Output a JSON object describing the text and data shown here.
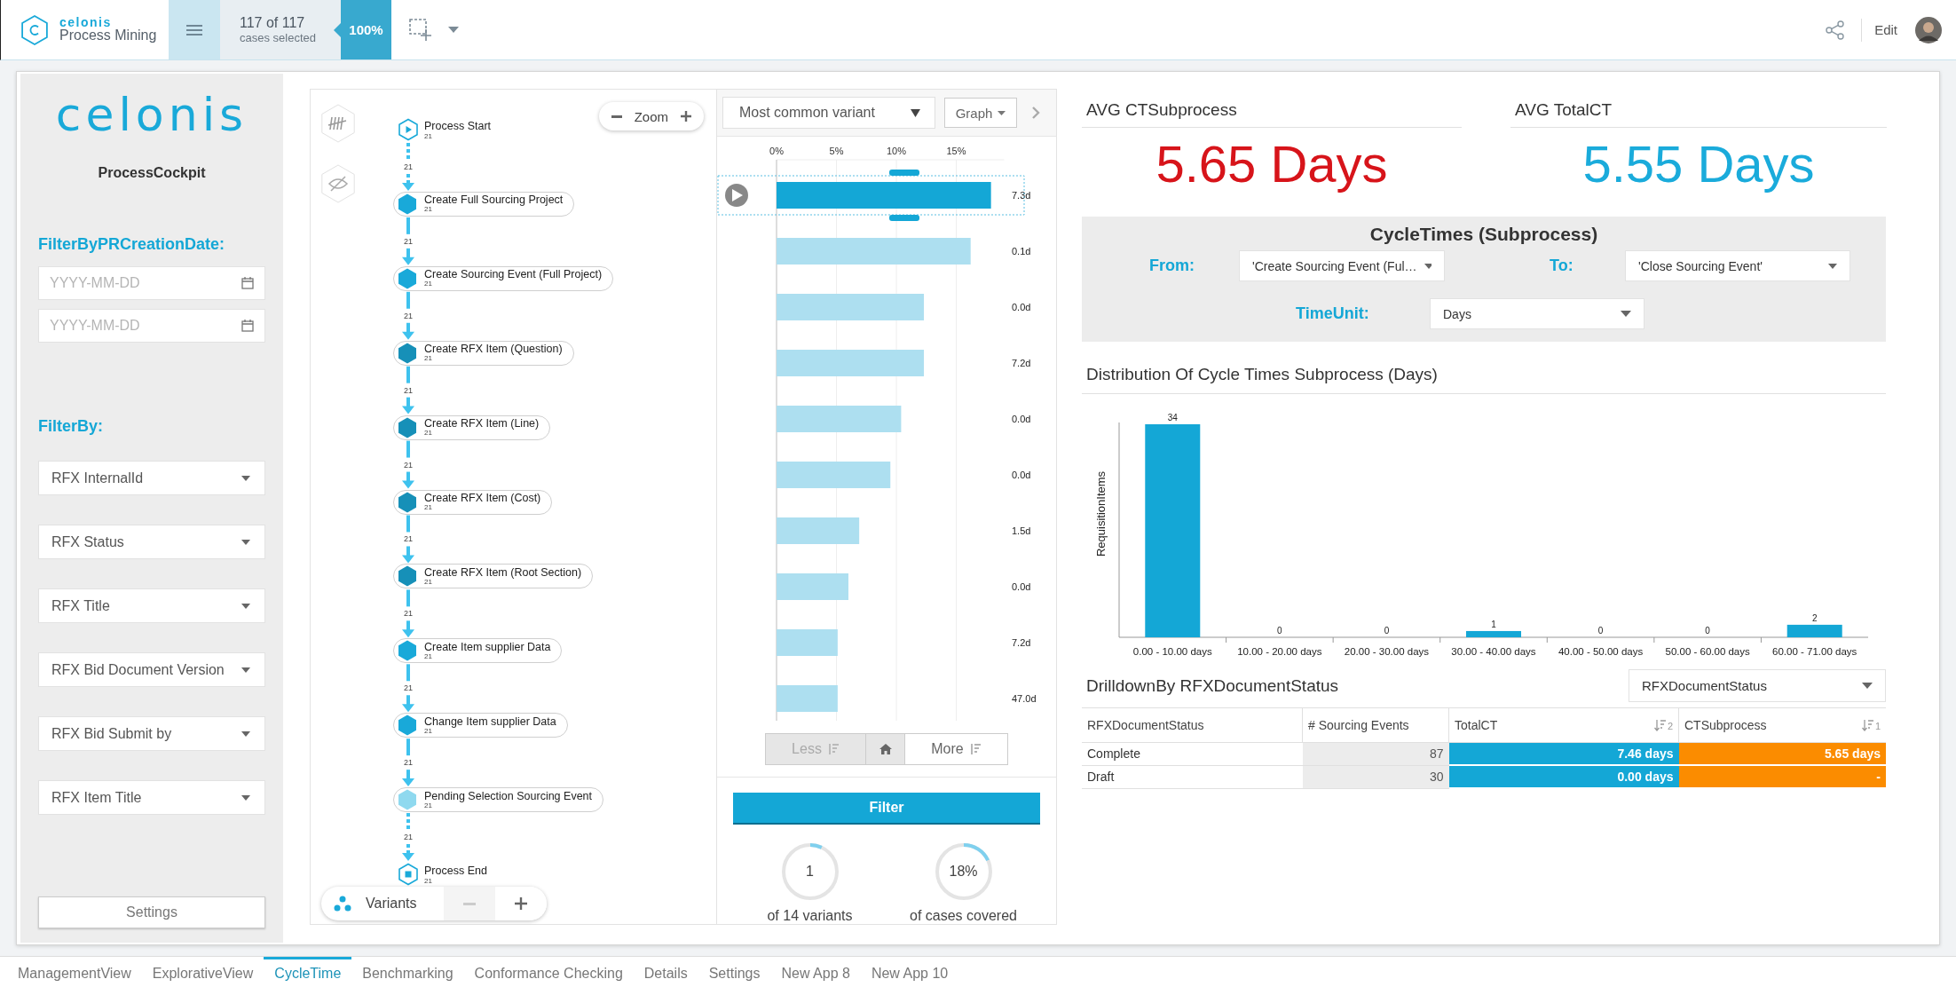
{
  "top_bar": {
    "brand": "celonis",
    "product": "Process Mining",
    "cases": "117 of 117",
    "cases_caption": "cases selected",
    "percent": "100%",
    "edit": "Edit"
  },
  "sidebar": {
    "logo": "celonis",
    "title": "ProcessCockpit",
    "date_heading": "FilterByPRCreationDate:",
    "date_fields": [
      {
        "placeholder": "YYYY-MM-DD"
      },
      {
        "placeholder": "YYYY-MM-DD"
      }
    ],
    "filter_heading": "FilterBy:",
    "filters": [
      "RFX InternalId",
      "RFX Status",
      "RFX Title",
      "RFX Bid Document Version",
      "RFX Bid Submit by",
      "RFX Item Title"
    ],
    "settings": "Settings"
  },
  "process_map": {
    "zoom": "Zoom",
    "variants": "Variants",
    "nodes": [
      {
        "kind": "start",
        "label": "Process Start",
        "count": "21"
      },
      {
        "kind": "activity",
        "label": "Create Full Sourcing Project",
        "count": "21",
        "color": "#19a9d9"
      },
      {
        "kind": "activity",
        "label": "Create Sourcing Event (Full Project)",
        "count": "21",
        "color": "#19a9d9"
      },
      {
        "kind": "activity",
        "label": "Create RFX Item (Question)",
        "count": "21",
        "color": "#1690b8"
      },
      {
        "kind": "activity",
        "label": "Create RFX Item (Line)",
        "count": "21",
        "color": "#1690b8"
      },
      {
        "kind": "activity",
        "label": "Create RFX Item (Cost)",
        "count": "21",
        "color": "#1690b8"
      },
      {
        "kind": "activity",
        "label": "Create RFX Item (Root Section)",
        "count": "21",
        "color": "#1690b8"
      },
      {
        "kind": "activity",
        "label": "Create Item supplier Data",
        "count": "21",
        "color": "#19a9d9"
      },
      {
        "kind": "activity",
        "label": "Change Item supplier Data",
        "count": "21",
        "color": "#19a9d9"
      },
      {
        "kind": "activity",
        "label": "Pending Selection Sourcing Event",
        "count": "21",
        "color": "#8fd9ef"
      },
      {
        "kind": "end",
        "label": "Process End",
        "count": "21"
      }
    ],
    "edges": [
      {
        "label": "21",
        "dashed": true
      },
      {
        "label": "21",
        "dashed": false
      },
      {
        "label": "21",
        "dashed": false
      },
      {
        "label": "21",
        "dashed": false
      },
      {
        "label": "21",
        "dashed": false
      },
      {
        "label": "21",
        "dashed": false
      },
      {
        "label": "21",
        "dashed": false
      },
      {
        "label": "21",
        "dashed": false
      },
      {
        "label": "21",
        "dashed": false
      },
      {
        "label": "21",
        "dashed": true
      }
    ]
  },
  "variant_explorer": {
    "dropdown": "Most common variant",
    "view": "Graph",
    "rows": [
      {
        "selected": true,
        "duration": "7.3d"
      },
      {
        "selected": false,
        "duration": "0.1d"
      },
      {
        "selected": false,
        "duration": "0.0d"
      },
      {
        "selected": false,
        "duration": "7.2d"
      },
      {
        "selected": false,
        "duration": "0.0d"
      },
      {
        "selected": false,
        "duration": "0.0d"
      },
      {
        "selected": false,
        "duration": "1.5d"
      },
      {
        "selected": false,
        "duration": "0.0d"
      },
      {
        "selected": false,
        "duration": "7.2d"
      },
      {
        "selected": false,
        "duration": "47.0d"
      }
    ],
    "chart_data": {
      "type": "bar",
      "orientation": "horizontal",
      "grid": true,
      "xlim": [
        0,
        19
      ],
      "xticks": [
        {
          "value": 0,
          "label": "0%"
        },
        {
          "value": 5,
          "label": "5%"
        },
        {
          "value": 10,
          "label": "10%"
        },
        {
          "value": 15,
          "label": "15%"
        }
      ],
      "series": [
        {
          "color": "#14a7d6",
          "values": [
            17.9,
            null,
            null,
            null,
            null,
            null,
            null,
            null,
            null,
            null
          ]
        },
        {
          "color": "#addff0",
          "values": [
            null,
            16.2,
            12.3,
            12.3,
            10.4,
            9.5,
            6.9,
            6.0,
            5.1,
            5.1
          ]
        }
      ]
    },
    "less": "Less",
    "more": "More",
    "filter": "Filter",
    "stats": [
      {
        "value": "1",
        "caption": "of 14 variants",
        "level": 0.07
      },
      {
        "value": "18%",
        "caption": "of cases covered",
        "level": 0.18
      }
    ]
  },
  "kpis": [
    {
      "label": "AVG CTSubprocess",
      "value": "5.65 Days",
      "color": "#d7141a"
    },
    {
      "label": "AVG TotalCT",
      "value": "5.55 Days",
      "color": "#1aabdb"
    }
  ],
  "cycle_times": {
    "title": "CycleTimes (Subprocess)",
    "from_label": "From:",
    "from_value": "'Create Sourcing Event (Ful…",
    "to_label": "To:",
    "to_value": "'Close Sourcing Event'",
    "unit_label": "TimeUnit:",
    "unit_value": "Days"
  },
  "distribution": {
    "chart_data": {
      "type": "bar",
      "title": "Distribution Of Cycle Times Subprocess (Days)",
      "ylabel": "RequisitionItems",
      "categories": [
        "0.00 - 10.00 days",
        "10.00 - 20.00 days",
        "20.00 - 30.00 days",
        "30.00 - 40.00 days",
        "40.00 - 50.00 days",
        "50.00 - 60.00 days",
        "60.00 - 71.00 days"
      ],
      "series": [
        {
          "color": "#14a7d6",
          "values": [
            34,
            0,
            0,
            1,
            0,
            0,
            2
          ]
        }
      ],
      "data_labels": true
    }
  },
  "drilldown": {
    "title": "DrilldownBy RFXDocumentStatus",
    "dropdown": "RFXDocumentStatus",
    "columns": [
      {
        "label": "RFXDocumentStatus"
      },
      {
        "label": "# Sourcing Events"
      },
      {
        "label": "TotalCT",
        "sort_rank": "2",
        "color": "#14a7d6"
      },
      {
        "label": "CTSubprocess",
        "sort_rank": "1",
        "color": "#fb8c00"
      }
    ],
    "rows": [
      [
        "Complete",
        "87",
        "7.46 days",
        "5.65 days"
      ],
      [
        "Draft",
        "30",
        "0.00 days",
        "-"
      ]
    ]
  },
  "tabs": [
    {
      "label": "ManagementView",
      "selected": false
    },
    {
      "label": "ExplorativeView",
      "selected": false
    },
    {
      "label": "CycleTime",
      "selected": true
    },
    {
      "label": "Benchmarking",
      "selected": false
    },
    {
      "label": "Conformance Checking",
      "selected": false
    },
    {
      "label": "Details",
      "selected": false
    },
    {
      "label": "Settings",
      "selected": false
    },
    {
      "label": "New App 8",
      "selected": false
    },
    {
      "label": "New App 10",
      "selected": false
    }
  ]
}
